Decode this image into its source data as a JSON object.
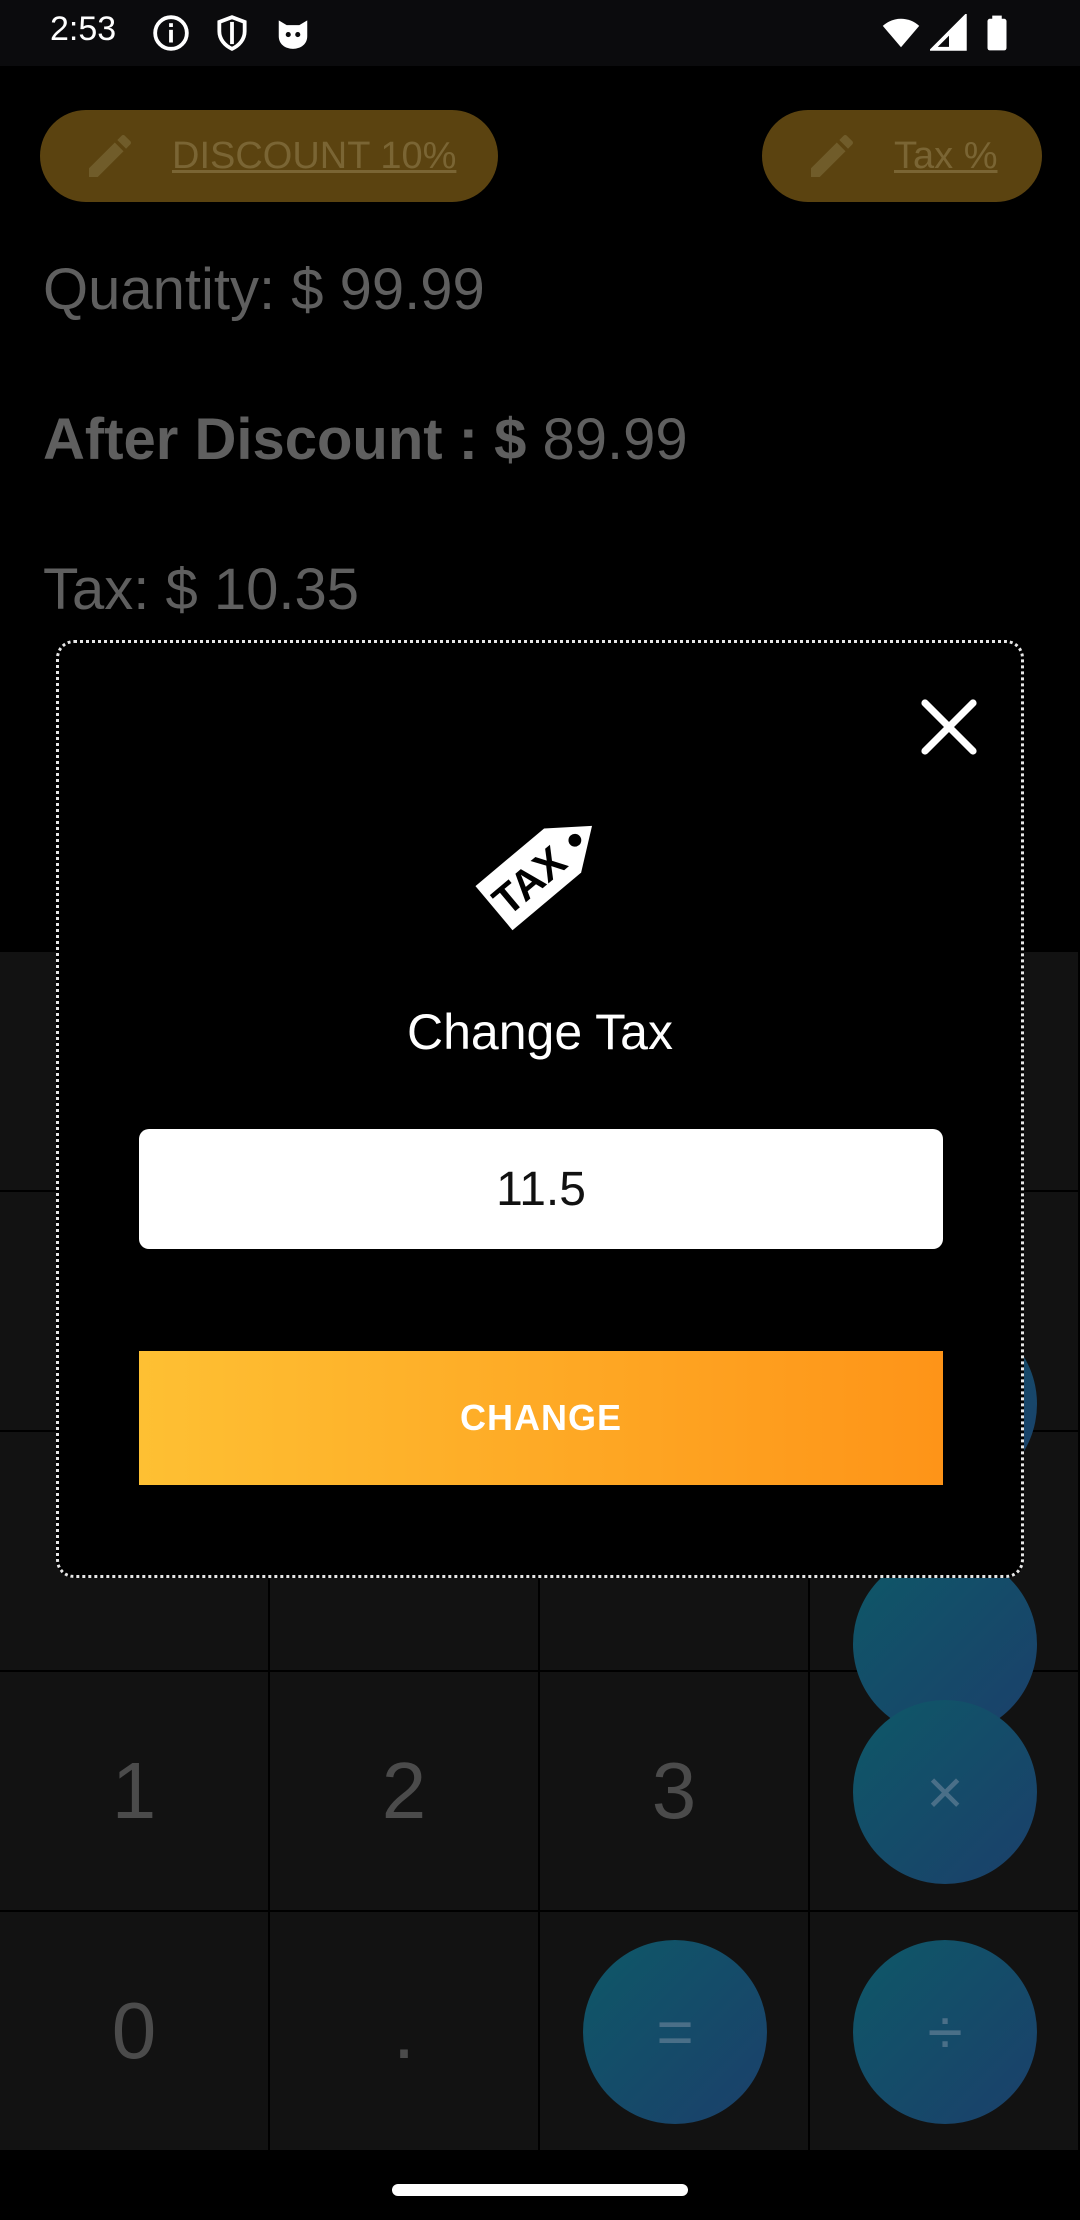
{
  "status_bar": {
    "time": "2:53",
    "left_icons": [
      "info-icon",
      "shield-icon",
      "cat-face-icon"
    ],
    "right_icons": [
      "wifi-icon",
      "signal-icon",
      "battery-icon"
    ]
  },
  "toolbar": {
    "discount_label": "DISCOUNT 10%",
    "tax_label": "Tax %"
  },
  "summary": {
    "quantity_label": "Quantity: $",
    "quantity_value": "99.99",
    "after_discount_label": "After Discount : $",
    "after_discount_value": "89.99",
    "tax_label": "Tax: $",
    "tax_value": "10.35"
  },
  "keypad": {
    "keys": [
      "1",
      "2",
      "3",
      "0",
      "."
    ],
    "operators": [
      "×",
      "=",
      "÷"
    ]
  },
  "dialog": {
    "title": "Change Tax",
    "input_value": "11.5",
    "button_label": "CHANGE",
    "icon_text": "TAX"
  },
  "colors": {
    "accent_start": "#fec033",
    "accent_end": "#fe9418",
    "operator_bg": "#1b3f6a"
  }
}
